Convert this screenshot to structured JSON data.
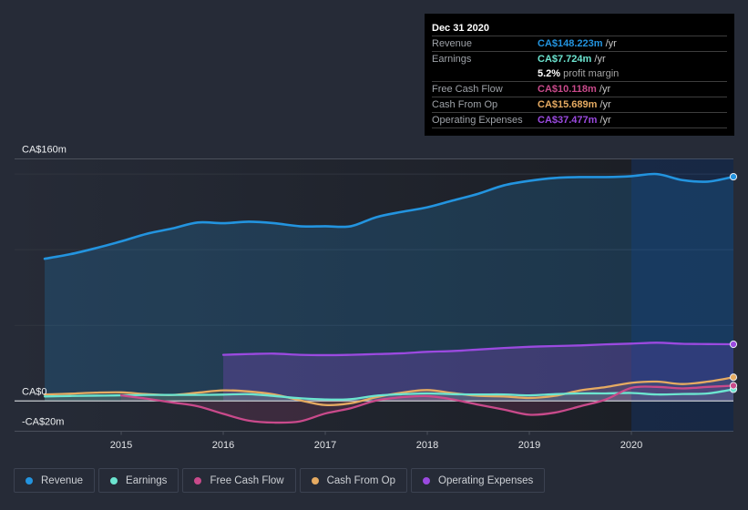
{
  "tooltip": {
    "date": "Dec 31 2020",
    "rows": [
      {
        "label": "Revenue",
        "value": "CA$148.223m",
        "unit": "/yr",
        "color": "#2394df"
      },
      {
        "label": "Earnings",
        "value": "CA$7.724m",
        "unit": "/yr",
        "color": "#6ce5d0"
      },
      {
        "label": "",
        "value": "5.2%",
        "unit": "profit margin",
        "color": "#ffffff"
      },
      {
        "label": "Free Cash Flow",
        "value": "CA$10.118m",
        "unit": "/yr",
        "color": "#c94a8b"
      },
      {
        "label": "Cash From Op",
        "value": "CA$15.689m",
        "unit": "/yr",
        "color": "#e6ab62"
      },
      {
        "label": "Operating Expenses",
        "value": "CA$37.477m",
        "unit": "/yr",
        "color": "#9b4ae0"
      }
    ]
  },
  "legend": [
    {
      "label": "Revenue",
      "color": "#2394df"
    },
    {
      "label": "Earnings",
      "color": "#6ce5d0"
    },
    {
      "label": "Free Cash Flow",
      "color": "#c94a8b"
    },
    {
      "label": "Cash From Op",
      "color": "#e6ab62"
    },
    {
      "label": "Operating Expenses",
      "color": "#9b4ae0"
    }
  ],
  "chart_data": {
    "type": "area",
    "title": "",
    "xlabel": "",
    "ylabel": "",
    "units": "CA$ millions",
    "ylim": [
      -20,
      160
    ],
    "xlim": [
      2013.955,
      2021.0
    ],
    "grid": true,
    "gridlines": [
      50,
      100,
      150
    ],
    "yticks": [
      {
        "value": 160,
        "label": "CA$160m"
      },
      {
        "value": 0,
        "label": "CA$0"
      },
      {
        "value": -20,
        "label": "-CA$20m"
      }
    ],
    "xticks": [
      {
        "value": 2015,
        "label": "2015"
      },
      {
        "value": 2016,
        "label": "2016"
      },
      {
        "value": 2017,
        "label": "2017"
      },
      {
        "value": 2018,
        "label": "2018"
      },
      {
        "value": 2019,
        "label": "2019"
      },
      {
        "value": 2020,
        "label": "2020"
      }
    ],
    "highlight_range": [
      2020.0,
      2021.0
    ],
    "legend_position": "bottom-left",
    "series": [
      {
        "name": "Revenue",
        "color": "#2394df",
        "fill": true,
        "points": [
          [
            2014.25,
            94
          ],
          [
            2014.5,
            97
          ],
          [
            2014.75,
            101
          ],
          [
            2015.0,
            105.5
          ],
          [
            2015.25,
            110.5
          ],
          [
            2015.5,
            114
          ],
          [
            2015.75,
            118
          ],
          [
            2016.0,
            117.5
          ],
          [
            2016.25,
            118.5
          ],
          [
            2016.5,
            117.5
          ],
          [
            2016.75,
            115.5
          ],
          [
            2017.0,
            115.5
          ],
          [
            2017.25,
            115.5
          ],
          [
            2017.5,
            121.5
          ],
          [
            2017.75,
            125
          ],
          [
            2018.0,
            128
          ],
          [
            2018.25,
            132.5
          ],
          [
            2018.5,
            137
          ],
          [
            2018.75,
            142.5
          ],
          [
            2019.0,
            145.5
          ],
          [
            2019.25,
            147.4
          ],
          [
            2019.5,
            148
          ],
          [
            2019.75,
            148
          ],
          [
            2020.0,
            148.6
          ],
          [
            2020.25,
            150
          ],
          [
            2020.5,
            146
          ],
          [
            2020.75,
            145
          ],
          [
            2021.0,
            148.223
          ]
        ]
      },
      {
        "name": "Operating Expenses",
        "color": "#9b4ae0",
        "fill": true,
        "points": [
          [
            2016.0,
            30.5
          ],
          [
            2016.25,
            31
          ],
          [
            2016.5,
            31.3
          ],
          [
            2016.75,
            30.5
          ],
          [
            2017.0,
            30.3
          ],
          [
            2017.25,
            30.5
          ],
          [
            2017.5,
            31
          ],
          [
            2017.75,
            31.5
          ],
          [
            2018.0,
            32.5
          ],
          [
            2018.25,
            33
          ],
          [
            2018.5,
            34
          ],
          [
            2018.75,
            35
          ],
          [
            2019.0,
            35.8
          ],
          [
            2019.25,
            36.3
          ],
          [
            2019.5,
            36.7
          ],
          [
            2019.75,
            37.4
          ],
          [
            2020.0,
            37.9
          ],
          [
            2020.25,
            38.5
          ],
          [
            2020.5,
            37.8
          ],
          [
            2020.75,
            37.6
          ],
          [
            2021.0,
            37.477
          ]
        ]
      },
      {
        "name": "Cash From Op",
        "color": "#e6ab62",
        "fill": true,
        "points": [
          [
            2014.25,
            4.3
          ],
          [
            2014.5,
            4.8
          ],
          [
            2014.75,
            5.5
          ],
          [
            2015.0,
            5.7
          ],
          [
            2015.25,
            4.5
          ],
          [
            2015.5,
            4
          ],
          [
            2015.75,
            5.5
          ],
          [
            2016.0,
            7
          ],
          [
            2016.25,
            6.3
          ],
          [
            2016.5,
            4.3
          ],
          [
            2016.75,
            0.5
          ],
          [
            2017.0,
            -2.7
          ],
          [
            2017.25,
            -1.5
          ],
          [
            2017.5,
            2.5
          ],
          [
            2017.75,
            5.5
          ],
          [
            2018.0,
            7.2
          ],
          [
            2018.25,
            5.2
          ],
          [
            2018.5,
            3.4
          ],
          [
            2018.75,
            3
          ],
          [
            2019.0,
            2
          ],
          [
            2019.25,
            3.4
          ],
          [
            2019.5,
            7
          ],
          [
            2019.75,
            9.2
          ],
          [
            2020.0,
            12
          ],
          [
            2020.25,
            12.8
          ],
          [
            2020.5,
            11.2
          ],
          [
            2020.75,
            12.8
          ],
          [
            2021.0,
            15.689
          ]
        ]
      },
      {
        "name": "Earnings",
        "color": "#6ce5d0",
        "fill": true,
        "points": [
          [
            2014.25,
            3
          ],
          [
            2014.5,
            3.3
          ],
          [
            2014.75,
            3.5
          ],
          [
            2015.0,
            3.7
          ],
          [
            2015.25,
            4
          ],
          [
            2015.5,
            4
          ],
          [
            2015.75,
            4
          ],
          [
            2016.0,
            4.2
          ],
          [
            2016.25,
            4.5
          ],
          [
            2016.5,
            3.3
          ],
          [
            2016.75,
            1.8
          ],
          [
            2017.0,
            1.0
          ],
          [
            2017.25,
            1.2
          ],
          [
            2017.5,
            3.5
          ],
          [
            2017.75,
            4.5
          ],
          [
            2018.0,
            5
          ],
          [
            2018.25,
            4.5
          ],
          [
            2018.5,
            4.3
          ],
          [
            2018.75,
            4.3
          ],
          [
            2019.0,
            3.7
          ],
          [
            2019.25,
            4.5
          ],
          [
            2019.5,
            5
          ],
          [
            2019.75,
            5
          ],
          [
            2020.0,
            5.3
          ],
          [
            2020.25,
            4.3
          ],
          [
            2020.5,
            4.6
          ],
          [
            2020.75,
            5
          ],
          [
            2021.0,
            7.724
          ]
        ]
      },
      {
        "name": "Free Cash Flow",
        "color": "#c94a8b",
        "fill": true,
        "points": [
          [
            2015.0,
            3.7
          ],
          [
            2015.25,
            1.5
          ],
          [
            2015.5,
            -1
          ],
          [
            2015.75,
            -3.5
          ],
          [
            2016.0,
            -8.5
          ],
          [
            2016.25,
            -13
          ],
          [
            2016.5,
            -14.3
          ],
          [
            2016.75,
            -13.5
          ],
          [
            2017.0,
            -8.3
          ],
          [
            2017.25,
            -4.8
          ],
          [
            2017.5,
            0.3
          ],
          [
            2017.75,
            2.5
          ],
          [
            2018.0,
            3.2
          ],
          [
            2018.25,
            1.0
          ],
          [
            2018.5,
            -2.5
          ],
          [
            2018.75,
            -5.7
          ],
          [
            2019.0,
            -9.1
          ],
          [
            2019.25,
            -7.7
          ],
          [
            2019.5,
            -3.5
          ],
          [
            2019.75,
            1.0
          ],
          [
            2020.0,
            8.7
          ],
          [
            2020.25,
            9.3
          ],
          [
            2020.5,
            8.3
          ],
          [
            2020.75,
            9.3
          ],
          [
            2021.0,
            10.118
          ]
        ]
      }
    ]
  }
}
